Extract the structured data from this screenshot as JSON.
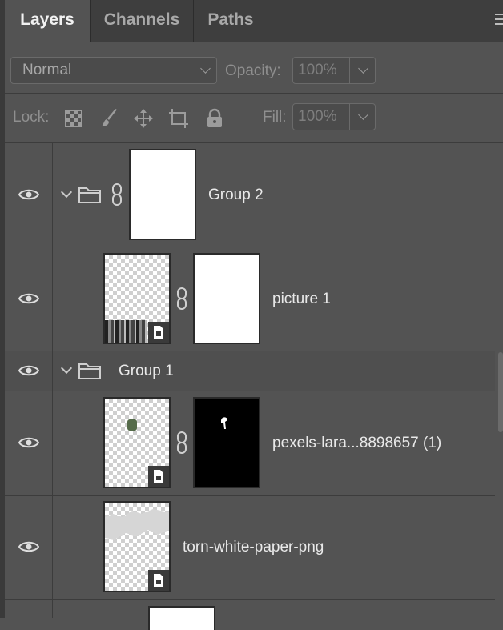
{
  "tabs": [
    {
      "label": "Layers",
      "active": true
    },
    {
      "label": "Channels",
      "active": false
    },
    {
      "label": "Paths",
      "active": false
    }
  ],
  "blend": {
    "mode": "Normal",
    "opacity_label": "Opacity:",
    "opacity_value": "100%"
  },
  "lock": {
    "label": "Lock:",
    "fill_label": "Fill:",
    "fill_value": "100%",
    "icons": [
      "lock-transparent-pixels-icon",
      "lock-image-pixels-icon",
      "lock-position-icon",
      "lock-artboard-icon",
      "lock-all-icon"
    ]
  },
  "layers": [
    {
      "name": "Group 2",
      "type": "group-with-mask",
      "visible": true
    },
    {
      "name": "picture 1",
      "type": "smart-object-with-mask",
      "visible": true
    },
    {
      "name": "Group 1",
      "type": "group",
      "visible": true
    },
    {
      "name": "pexels-lara...8898657 (1)",
      "type": "smart-object-with-mask",
      "visible": true
    },
    {
      "name": "torn-white-paper-png",
      "type": "smart-object",
      "visible": true
    }
  ],
  "colors": {
    "panel": "#535353",
    "tabbar": "#3e3e3e",
    "text": "#e9e9e9"
  }
}
